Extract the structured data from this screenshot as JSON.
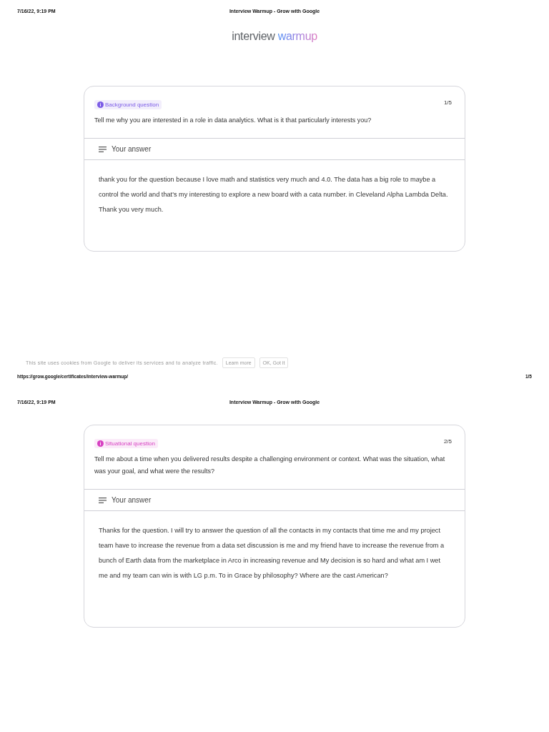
{
  "pages": [
    {
      "header": {
        "date": "7/16/22, 9:19 PM",
        "title": "Interview Warmup - Grow with Google"
      },
      "logo": {
        "first": "interview",
        "second": "warmup"
      },
      "card": {
        "tag": "Background question",
        "color": "#7b5be6",
        "counter": "1/5",
        "question": "Tell me why you are interested in a role in data analytics. What is it that particularly interests you?",
        "answer_label": "Your answer",
        "answer": "thank you for the question because I love math and statistics very much and 4.0. The data has a big role to maybe a control the world and that's my interesting to explore a new board with a cata number. in Cleveland Alpha Lambda Delta. Thank you very much."
      },
      "cookie": {
        "text": "This site uses cookies from Google to deliver its services and to analyze traffic.",
        "buttons": [
          "Learn more",
          "OK, Got it"
        ]
      },
      "footer": {
        "url": "https://grow.google/certificates/interview-warmup/",
        "page": "1/5"
      }
    },
    {
      "header": {
        "date": "7/16/22, 9:19 PM",
        "title": "Interview Warmup - Grow with Google"
      },
      "card": {
        "tag": "Situational question",
        "color": "#d63fc1",
        "counter": "2/5",
        "question": "Tell me about a time when you delivered results despite a challenging environment or context. What was the situation, what was your goal, and what were the results?",
        "answer_label": "Your answer",
        "answer": "Thanks for the question. I will try to answer the question of all the contacts in my contacts that time me and my project team have to increase the revenue from a data set discussion is me and my friend have to increase the revenue from a bunch of Earth data from the marketplace in Arco in increasing revenue and My decision is so hard and what am I wet me and my team can win is with LG p.m. To in Grace by philosophy? Where are the cast American?"
      }
    }
  ]
}
